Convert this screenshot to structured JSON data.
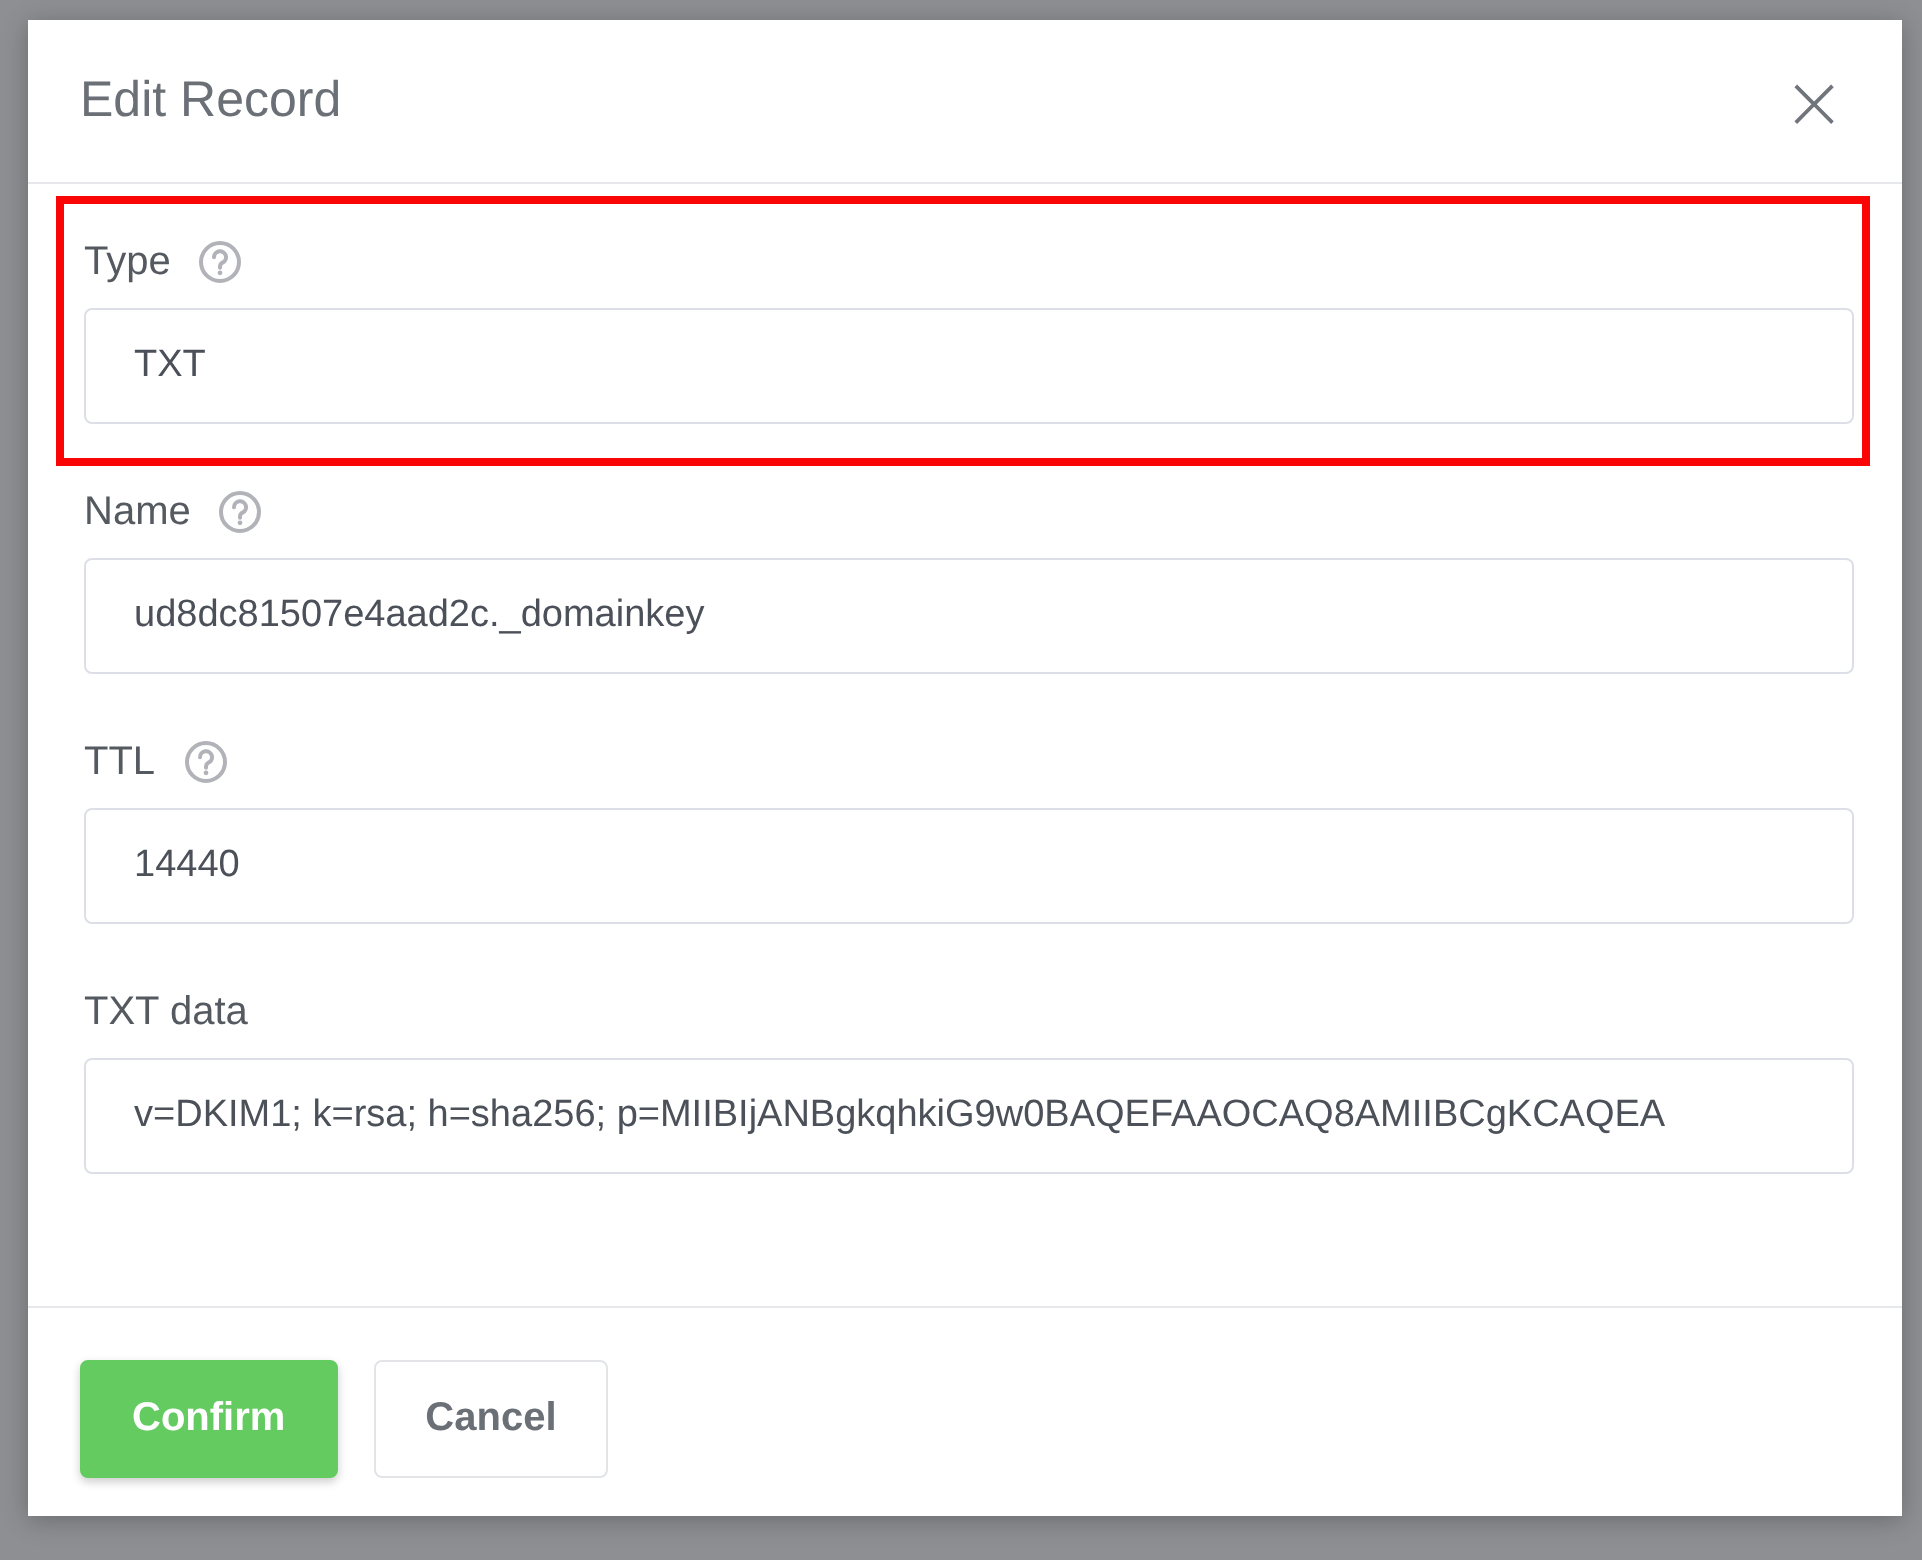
{
  "dialog": {
    "title": "Edit Record",
    "close": "×",
    "fields": [
      {
        "label": "Type",
        "help": true,
        "highlighted": true,
        "value": "TXT"
      },
      {
        "label": "Name",
        "help": true,
        "highlighted": false,
        "value": "ud8dc81507e4aad2c._domainkey"
      },
      {
        "label": "TTL",
        "help": true,
        "highlighted": false,
        "value": "14440"
      },
      {
        "label": "TXT data",
        "help": false,
        "highlighted": false,
        "value": "v=DKIM1; k=rsa; h=sha256; p=MIIBIjANBgkqhkiG9w0BAQEFAAOCAQ8AMIIBCgKCAQEA"
      }
    ],
    "buttons": [
      {
        "label": "Confirm",
        "kind": "primary"
      },
      {
        "label": "Cancel",
        "kind": "secondary"
      }
    ]
  }
}
